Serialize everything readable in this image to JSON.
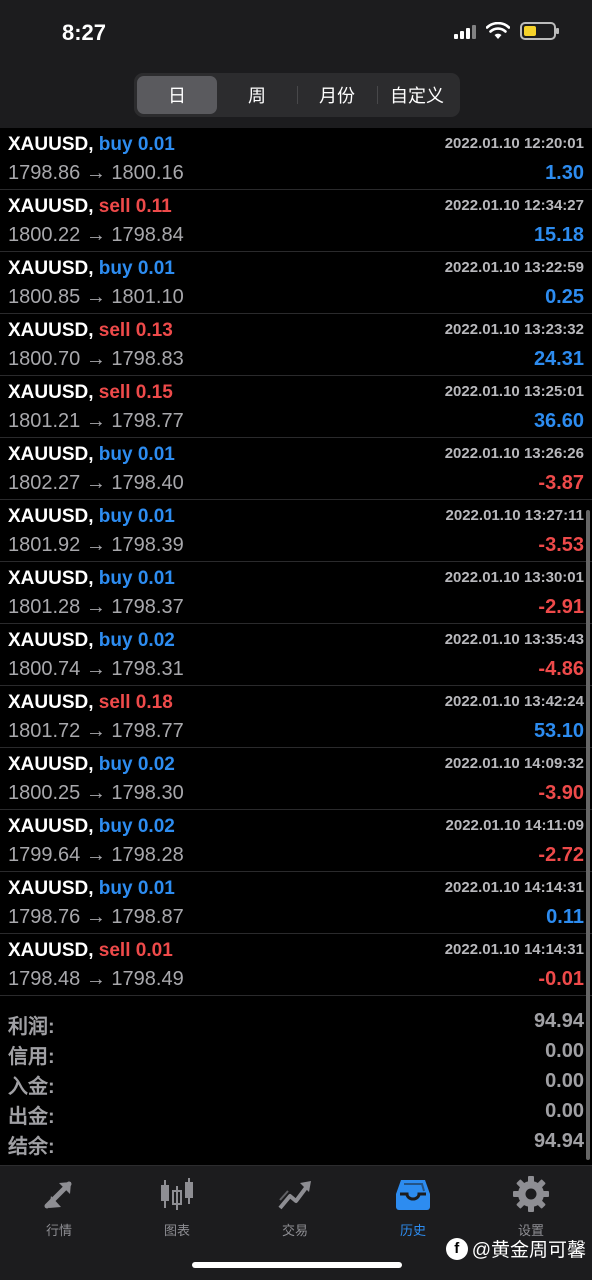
{
  "status_bar": {
    "time": "8:27"
  },
  "period_tabs": [
    {
      "label": "日",
      "active": true
    },
    {
      "label": "周",
      "active": false
    },
    {
      "label": "月份",
      "active": false
    },
    {
      "label": "自定义",
      "active": false
    }
  ],
  "deals": [
    {
      "symbol": "XAUUSD,",
      "side": "buy",
      "volume": "0.01",
      "time": "2022.01.10 12:20:01",
      "open": "1798.86",
      "arrow": "→",
      "close": "1800.16",
      "profit": "1.30"
    },
    {
      "symbol": "XAUUSD,",
      "side": "sell",
      "volume": "0.11",
      "time": "2022.01.10 12:34:27",
      "open": "1800.22",
      "arrow": "→",
      "close": "1798.84",
      "profit": "15.18"
    },
    {
      "symbol": "XAUUSD,",
      "side": "buy",
      "volume": "0.01",
      "time": "2022.01.10 13:22:59",
      "open": "1800.85",
      "arrow": "→",
      "close": "1801.10",
      "profit": "0.25"
    },
    {
      "symbol": "XAUUSD,",
      "side": "sell",
      "volume": "0.13",
      "time": "2022.01.10 13:23:32",
      "open": "1800.70",
      "arrow": "→",
      "close": "1798.83",
      "profit": "24.31"
    },
    {
      "symbol": "XAUUSD,",
      "side": "sell",
      "volume": "0.15",
      "time": "2022.01.10 13:25:01",
      "open": "1801.21",
      "arrow": "→",
      "close": "1798.77",
      "profit": "36.60"
    },
    {
      "symbol": "XAUUSD,",
      "side": "buy",
      "volume": "0.01",
      "time": "2022.01.10 13:26:26",
      "open": "1802.27",
      "arrow": "→",
      "close": "1798.40",
      "profit": "-3.87"
    },
    {
      "symbol": "XAUUSD,",
      "side": "buy",
      "volume": "0.01",
      "time": "2022.01.10 13:27:11",
      "open": "1801.92",
      "arrow": "→",
      "close": "1798.39",
      "profit": "-3.53"
    },
    {
      "symbol": "XAUUSD,",
      "side": "buy",
      "volume": "0.01",
      "time": "2022.01.10 13:30:01",
      "open": "1801.28",
      "arrow": "→",
      "close": "1798.37",
      "profit": "-2.91"
    },
    {
      "symbol": "XAUUSD,",
      "side": "buy",
      "volume": "0.02",
      "time": "2022.01.10 13:35:43",
      "open": "1800.74",
      "arrow": "→",
      "close": "1798.31",
      "profit": "-4.86"
    },
    {
      "symbol": "XAUUSD,",
      "side": "sell",
      "volume": "0.18",
      "time": "2022.01.10 13:42:24",
      "open": "1801.72",
      "arrow": "→",
      "close": "1798.77",
      "profit": "53.10"
    },
    {
      "symbol": "XAUUSD,",
      "side": "buy",
      "volume": "0.02",
      "time": "2022.01.10 14:09:32",
      "open": "1800.25",
      "arrow": "→",
      "close": "1798.30",
      "profit": "-3.90"
    },
    {
      "symbol": "XAUUSD,",
      "side": "buy",
      "volume": "0.02",
      "time": "2022.01.10 14:11:09",
      "open": "1799.64",
      "arrow": "→",
      "close": "1798.28",
      "profit": "-2.72"
    },
    {
      "symbol": "XAUUSD,",
      "side": "buy",
      "volume": "0.01",
      "time": "2022.01.10 14:14:31",
      "open": "1798.76",
      "arrow": "→",
      "close": "1798.87",
      "profit": "0.11"
    },
    {
      "symbol": "XAUUSD,",
      "side": "sell",
      "volume": "0.01",
      "time": "2022.01.10 14:14:31",
      "open": "1798.48",
      "arrow": "→",
      "close": "1798.49",
      "profit": "-0.01"
    }
  ],
  "summary": [
    {
      "label": "利润:",
      "value": "94.94"
    },
    {
      "label": "信用:",
      "value": "0.00"
    },
    {
      "label": "入金:",
      "value": "0.00"
    },
    {
      "label": "出金:",
      "value": "0.00"
    },
    {
      "label": "结余:",
      "value": "94.94"
    }
  ],
  "tabbar": [
    {
      "label": "行情",
      "icon": "quotes-arrows-icon",
      "active": false
    },
    {
      "label": "图表",
      "icon": "candlestick-chart-icon",
      "active": false
    },
    {
      "label": "交易",
      "icon": "trade-chart-icon",
      "active": false
    },
    {
      "label": "历史",
      "icon": "history-inbox-icon",
      "active": true
    },
    {
      "label": "设置",
      "icon": "gear-icon",
      "active": false
    }
  ],
  "watermark": {
    "text": "@黄金周可馨"
  },
  "colors": {
    "buy": "#2d8cf0",
    "sell": "#ee4a4a",
    "accent": "#2d8cf0"
  }
}
